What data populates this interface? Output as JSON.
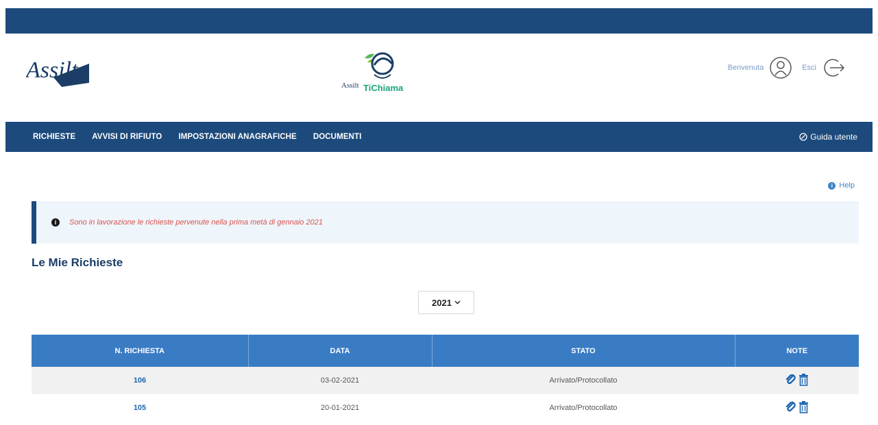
{
  "header": {
    "logo_text": "Assilt",
    "center_logo_text_1": "Assilt",
    "center_logo_text_2": "TiChiama",
    "welcome": "Benvenuta",
    "logout": "Esci"
  },
  "nav": {
    "items": [
      {
        "label": "RICHIESTE"
      },
      {
        "label": "AVVISI DI RIFIUTO"
      },
      {
        "label": "IMPOSTAZIONI ANAGRAFICHE"
      },
      {
        "label": "DOCUMENTI"
      }
    ],
    "guide": "Guida utente"
  },
  "help": "Help",
  "alert": {
    "text": "Sono in lavorazione le richieste pervenute nella prima metà di gennaio 2021"
  },
  "section_title": "Le Mie Richieste",
  "year_select": {
    "value": "2021"
  },
  "table": {
    "columns": [
      "N. RICHIESTA",
      "DATA",
      "STATO",
      "NOTE"
    ],
    "rows": [
      {
        "number": "106",
        "date": "03-02-2021",
        "status": "Arrivato/Protocollato"
      },
      {
        "number": "105",
        "date": "20-01-2021",
        "status": "Arrivato/Protocollato"
      }
    ]
  },
  "colors": {
    "navy": "#1d4a7c",
    "table_header": "#3a7cc4",
    "alert_text": "#d9534f",
    "link_blue": "#1e66b0"
  }
}
